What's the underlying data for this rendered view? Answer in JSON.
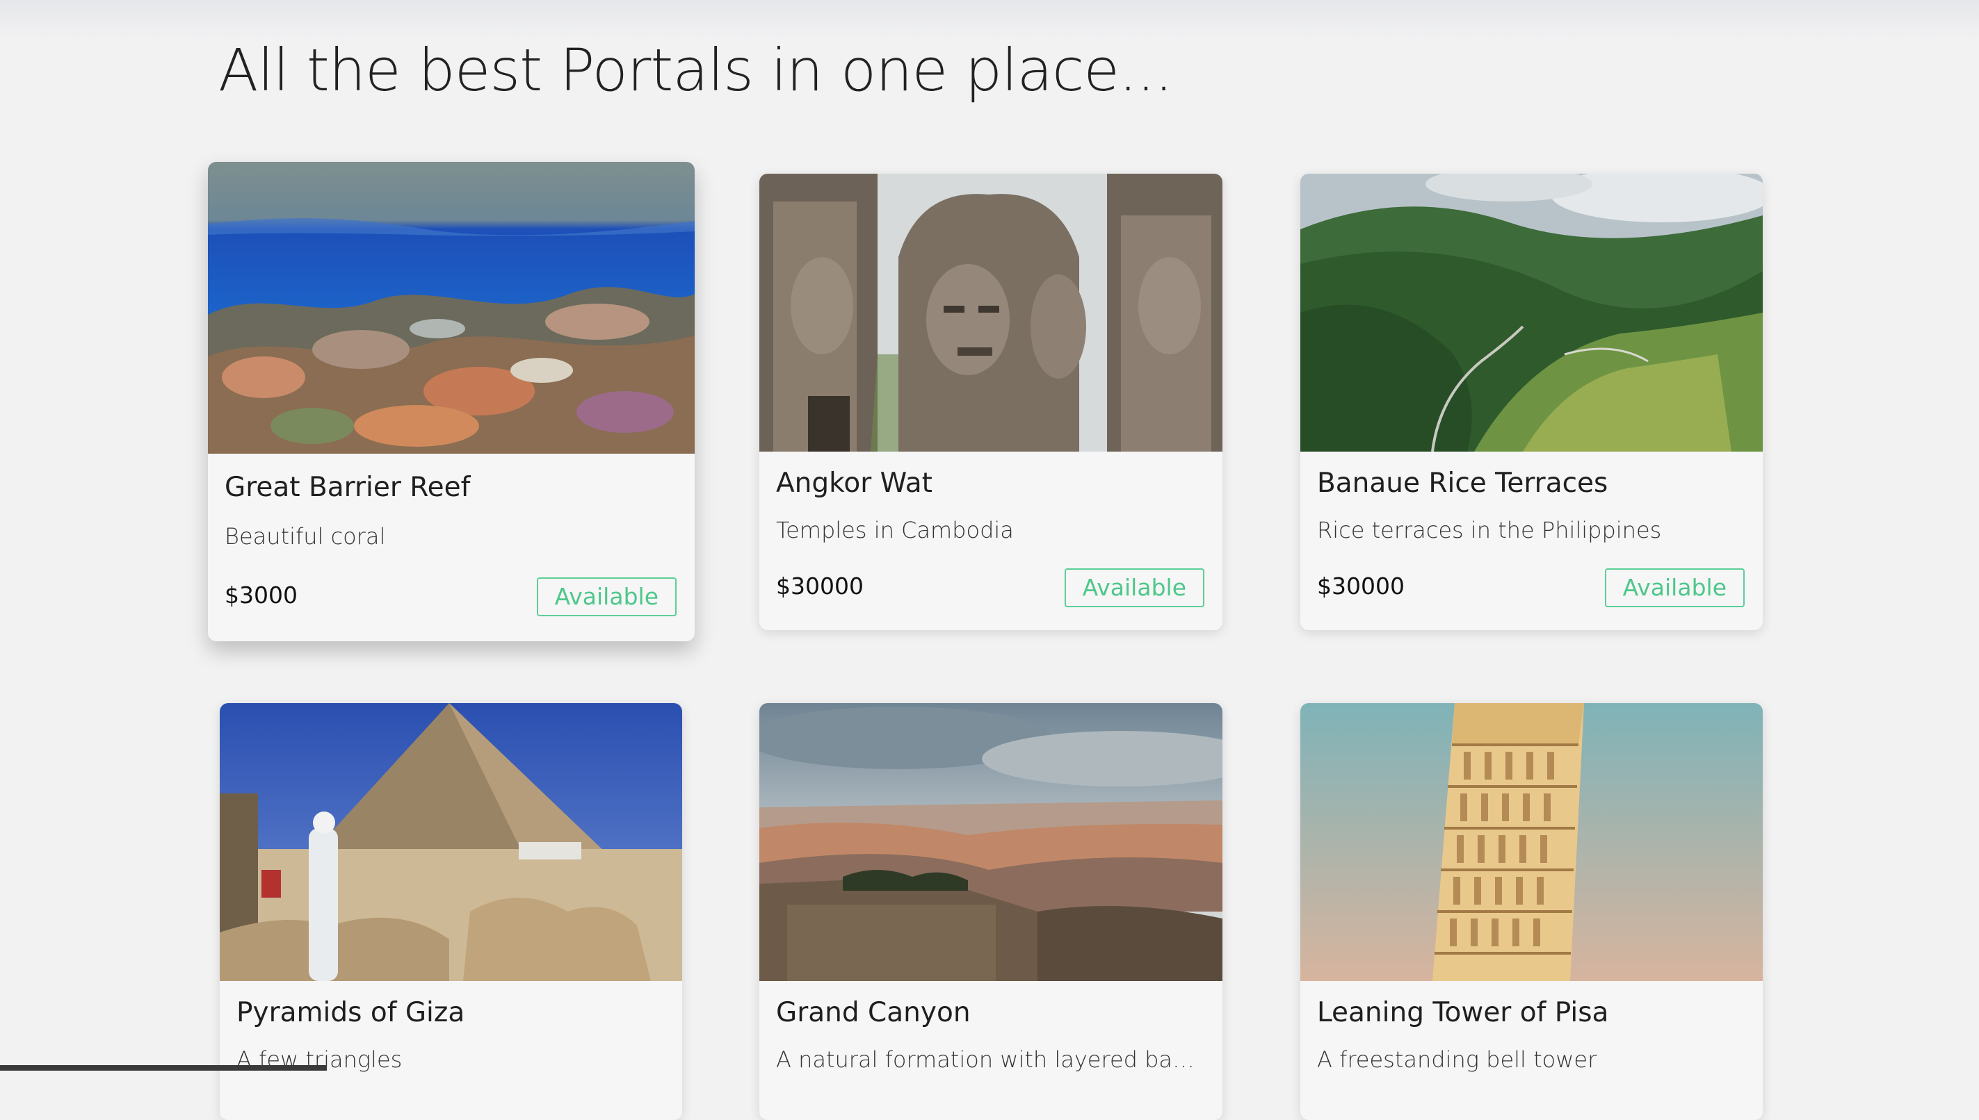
{
  "page": {
    "heading": "All the best Portals in one place..."
  },
  "portals": [
    {
      "title": "Great Barrier Reef",
      "description": "Beautiful coral",
      "price": "$3000",
      "status": "Available",
      "image_icon": "coral-reef-image"
    },
    {
      "title": "Angkor Wat",
      "description": "Temples in Cambodia",
      "price": "$30000",
      "status": "Available",
      "image_icon": "temple-faces-image"
    },
    {
      "title": "Banaue Rice Terraces",
      "description": "Rice terraces in the Philippines",
      "price": "$30000",
      "status": "Available",
      "image_icon": "green-valley-image"
    },
    {
      "title": "Pyramids of Giza",
      "description": "A few triangles",
      "image_icon": "pyramid-image"
    },
    {
      "title": "Grand Canyon",
      "description": "A natural formation with layered bands of ...",
      "image_icon": "canyon-image"
    },
    {
      "title": "Leaning Tower of Pisa",
      "description": "A freestanding bell tower",
      "image_icon": "leaning-tower-image"
    }
  ],
  "colors": {
    "background": "#f2f2f3",
    "card": "#f6f6f7",
    "status_green": "#4fc78a"
  }
}
